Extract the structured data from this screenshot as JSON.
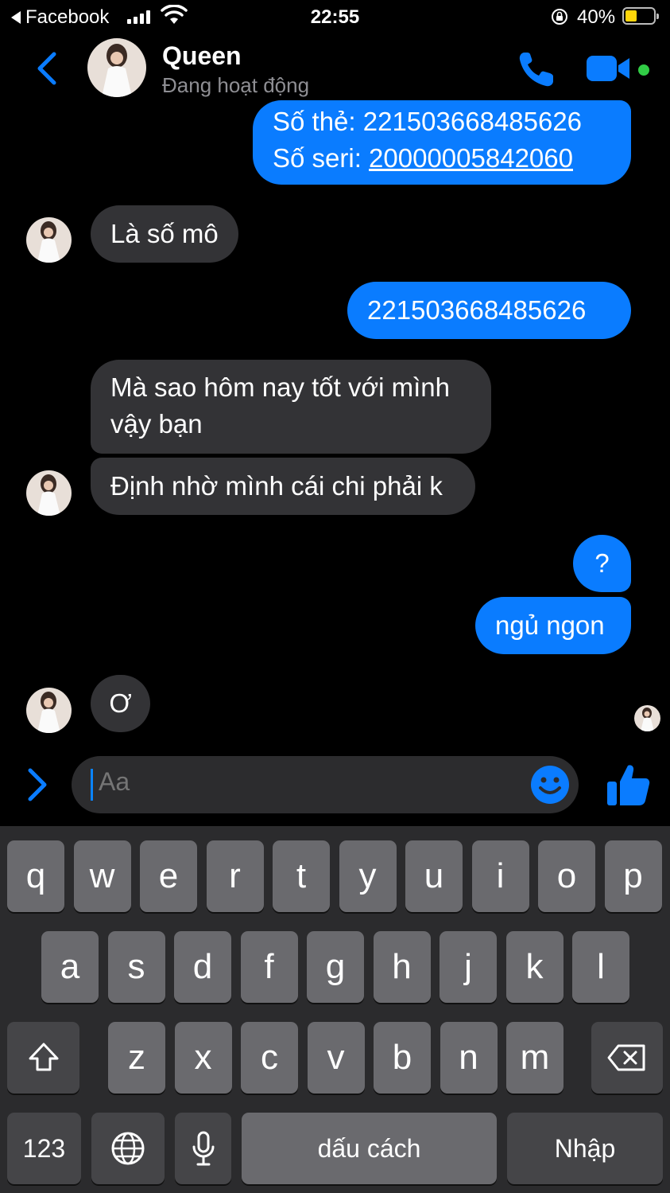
{
  "status_bar": {
    "back_app": "Facebook",
    "time": "22:55",
    "battery_percent": "40%",
    "battery_level": 0.4,
    "battery_color": "#ffd60a"
  },
  "header": {
    "contact_name": "Queen",
    "contact_status": "Đang hoạt động",
    "icons": [
      "back-chevron-icon",
      "phone-icon",
      "video-camera-icon"
    ],
    "accent_color": "#0a7cff",
    "online_color": "#31cc46"
  },
  "messages": [
    {
      "direction": "out",
      "lines": [
        "Số thẻ: 221503668485626",
        "Số seri: 20000005842060"
      ],
      "seri_label": "Số seri: ",
      "seri_value": "20000005842060"
    },
    {
      "direction": "in",
      "text": "Là số mô"
    },
    {
      "direction": "out",
      "text": "221503668485626"
    },
    {
      "direction": "in",
      "text": "Mà sao hôm nay tốt với mình",
      "text2": "vậy bạn"
    },
    {
      "direction": "in",
      "text": "Định nhờ mình cái chi phải k"
    },
    {
      "direction": "out",
      "text": "?"
    },
    {
      "direction": "out",
      "text": "ngủ ngon"
    },
    {
      "direction": "in",
      "text": "Ơ"
    }
  ],
  "composer": {
    "placeholder": "Aa",
    "icons": [
      "expand-arrow-icon",
      "emoji-icon",
      "thumbs-up-icon"
    ]
  },
  "keyboard": {
    "row1": [
      "q",
      "w",
      "e",
      "r",
      "t",
      "y",
      "u",
      "i",
      "o",
      "p"
    ],
    "row2": [
      "a",
      "s",
      "d",
      "f",
      "g",
      "h",
      "j",
      "k",
      "l"
    ],
    "row3": [
      "z",
      "x",
      "c",
      "v",
      "b",
      "n",
      "m"
    ],
    "numbers_key": "123",
    "space_key": "dấu cách",
    "return_key": "Nhập",
    "icons": [
      "shift-icon",
      "backspace-icon",
      "globe-icon",
      "microphone-icon"
    ]
  }
}
